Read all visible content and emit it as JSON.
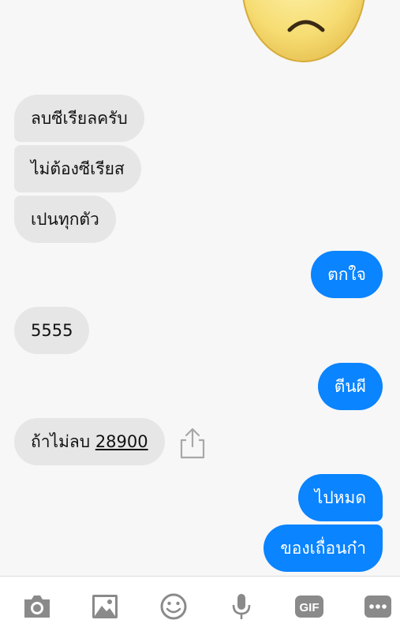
{
  "colors": {
    "outgoing_bubble": "#0a84ff",
    "incoming_bubble": "#e6e6e6",
    "background": "#f7f7f7",
    "toolbar_icon": "#8a8a8a"
  },
  "messages": [
    {
      "direction": "incoming",
      "text": "ลบซีเรียลครับ"
    },
    {
      "direction": "incoming",
      "text": "ไม่ต้องซีเรียส"
    },
    {
      "direction": "incoming",
      "text": "เปนทุกตัว"
    },
    {
      "direction": "outgoing",
      "text": "ตกใจ"
    },
    {
      "direction": "incoming",
      "text": "5555"
    },
    {
      "direction": "outgoing",
      "text": "ตีนผี"
    },
    {
      "direction": "incoming",
      "text_prefix": "ถ้าไม่ลบ",
      "link_text": "28900"
    },
    {
      "direction": "outgoing",
      "text": "ไปหมด"
    },
    {
      "direction": "outgoing",
      "text": "ของเถื่อนก๋า"
    }
  ],
  "sticker": {
    "icon": "sad-face-sticker"
  },
  "toolbar": {
    "icons": [
      "camera-icon",
      "image-icon",
      "emoji-icon",
      "microphone-icon",
      "gif-icon",
      "more-icon"
    ],
    "gif_label": "GIF"
  }
}
